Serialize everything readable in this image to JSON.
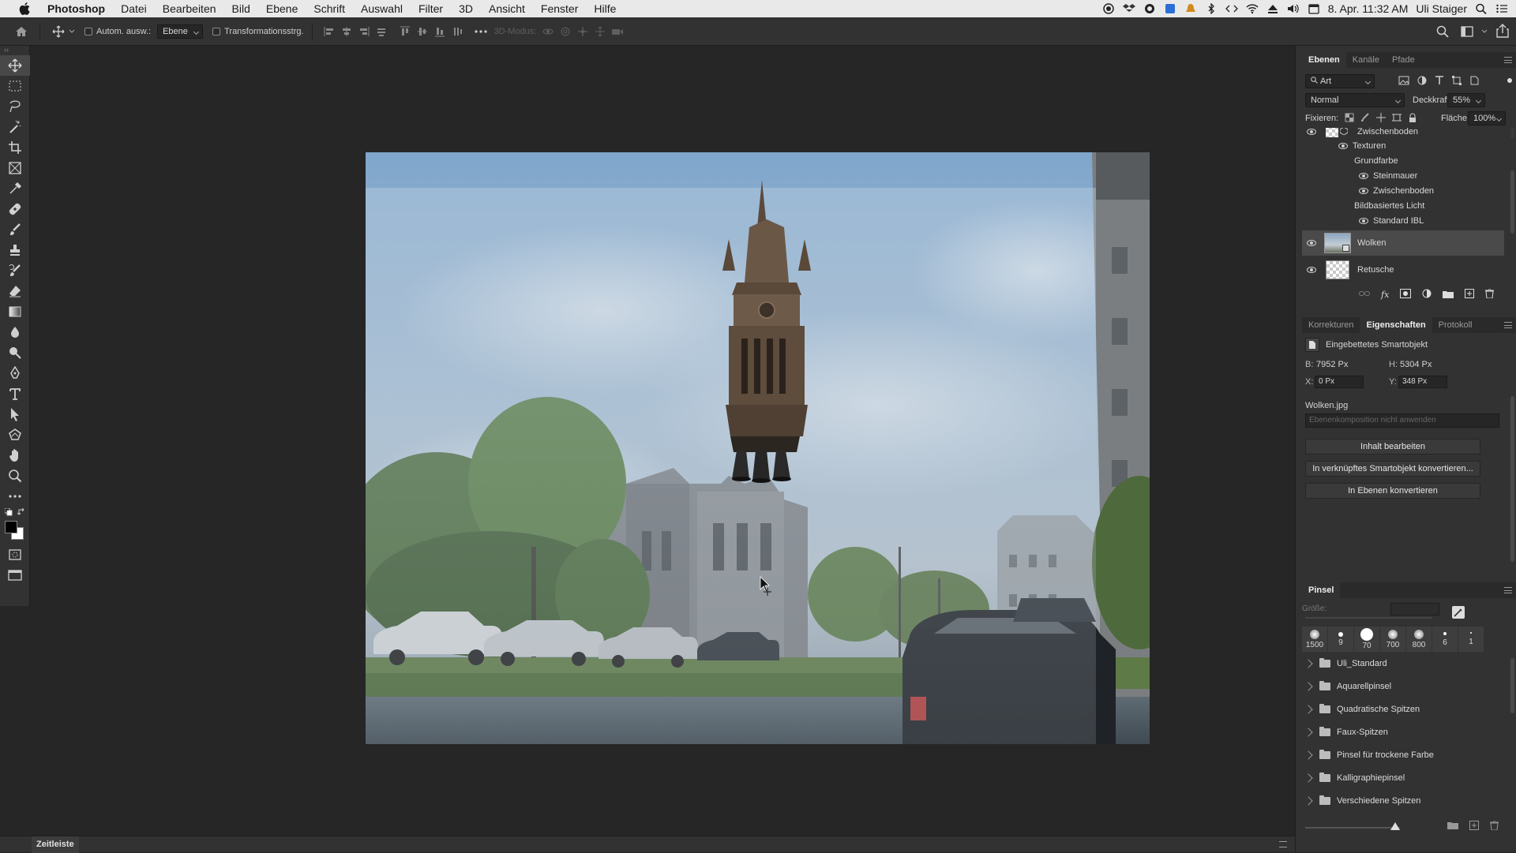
{
  "menubar": {
    "app": "Photoshop",
    "items": [
      "Datei",
      "Bearbeiten",
      "Bild",
      "Ebene",
      "Schrift",
      "Auswahl",
      "Filter",
      "3D",
      "Ansicht",
      "Fenster",
      "Hilfe"
    ],
    "clock": "8. Apr. 11:32 AM",
    "user": "Uli Staiger"
  },
  "options_bar": {
    "auto_select_label": "Autom. ausw.:",
    "auto_select_value": "Ebene",
    "transform_label": "Transformationsstrg.",
    "mode_3d_label": "3D-Modus:"
  },
  "layers_panel": {
    "tabs": [
      "Ebenen",
      "Kanäle",
      "Pfade"
    ],
    "filter_kind": "Art",
    "blend_mode": "Normal",
    "opacity_label": "Deckkraft:",
    "opacity_value": "55%",
    "lock_label": "Fixieren:",
    "fill_label": "Fläche:",
    "fill_value": "100%",
    "rows": [
      {
        "name": "Zwischenboden",
        "visible": true
      },
      {
        "name": "Texturen",
        "visible": true
      },
      {
        "name": "Grundfarbe",
        "visible": false
      },
      {
        "name": "Steinmauer",
        "visible": true
      },
      {
        "name": "Zwischenboden",
        "visible": true
      },
      {
        "name": "Bildbasiertes Licht",
        "visible": false
      },
      {
        "name": "Standard IBL",
        "visible": true
      },
      {
        "name": "Wolken",
        "visible": true,
        "selected": true
      },
      {
        "name": "Retusche",
        "visible": true
      }
    ],
    "footer_fx": "fx"
  },
  "properties_panel": {
    "tabs": [
      "Korrekturen",
      "Eigenschaften",
      "Protokoll"
    ],
    "title": "Eingebettetes Smartobjekt",
    "w_label": "B:",
    "w_value": "7952 Px",
    "h_label": "H:",
    "h_value": "5304 Px",
    "x_label": "X:",
    "x_value": "0 Px",
    "y_label": "Y:",
    "y_value": "348 Px",
    "filename": "Wolken.jpg",
    "comp_placeholder": "Ebenenkomposition nicht anwenden",
    "buttons": [
      "Inhalt bearbeiten",
      "In verknüpftes Smartobjekt konvertieren...",
      "In Ebenen konvertieren"
    ]
  },
  "brush_panel": {
    "tab": "Pinsel",
    "size_label": "Größe:",
    "presets": [
      "1500",
      "9",
      "70",
      "700",
      "800",
      "6",
      "1"
    ],
    "folders": [
      "Uli_Standard",
      "Aquarellpinsel",
      "Quadratische Spitzen",
      "Faux-Spitzen",
      "Pinsel für trockene Farbe",
      "Kalligraphiepinsel",
      "Verschiedene Spitzen"
    ]
  },
  "timeline": {
    "tab": "Zeitleiste"
  }
}
